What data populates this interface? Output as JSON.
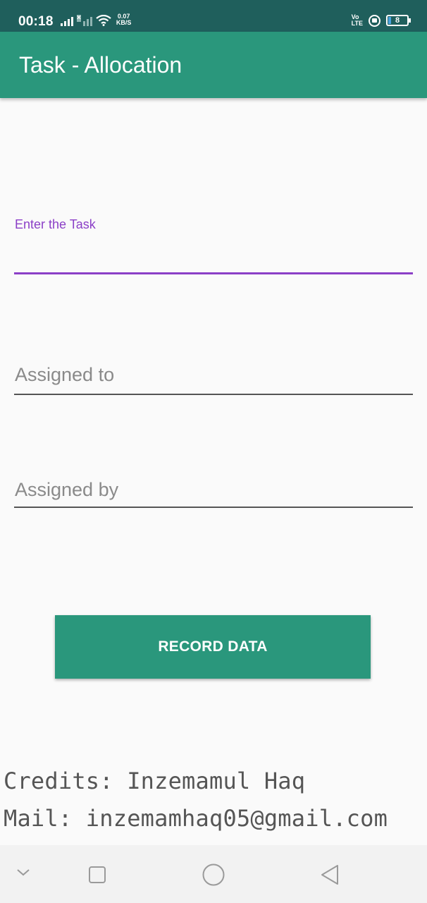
{
  "status_bar": {
    "time": "00:18",
    "speed_value": "0.07",
    "speed_unit": "KB/S",
    "volte_top": "Vo",
    "volte_bottom": "LTE",
    "battery_level": "8",
    "icons": [
      "signal-icon",
      "signal-off-icon",
      "wifi-icon",
      "volte-icon",
      "lock-rotation-icon",
      "battery-icon"
    ]
  },
  "app_bar": {
    "title": "Task - Allocation"
  },
  "form": {
    "task": {
      "label": "Enter the Task",
      "value": ""
    },
    "assigned_to": {
      "placeholder": "Assigned to",
      "value": ""
    },
    "assigned_by": {
      "placeholder": "Assigned by",
      "value": ""
    },
    "record_button": "RECORD DATA"
  },
  "credits": {
    "line1": "Credits: Inzemamul Haq",
    "line2": "Mail: inzemamhaq05@gmail.com"
  },
  "nav_bar": {
    "icons": [
      "chevron-down-icon",
      "recents-square-icon",
      "home-circle-icon",
      "back-triangle-icon"
    ]
  },
  "colors": {
    "status_bar": "#1f5f5c",
    "primary": "#2a977c",
    "accent": "#8b3fc7",
    "background": "#fafafa"
  }
}
